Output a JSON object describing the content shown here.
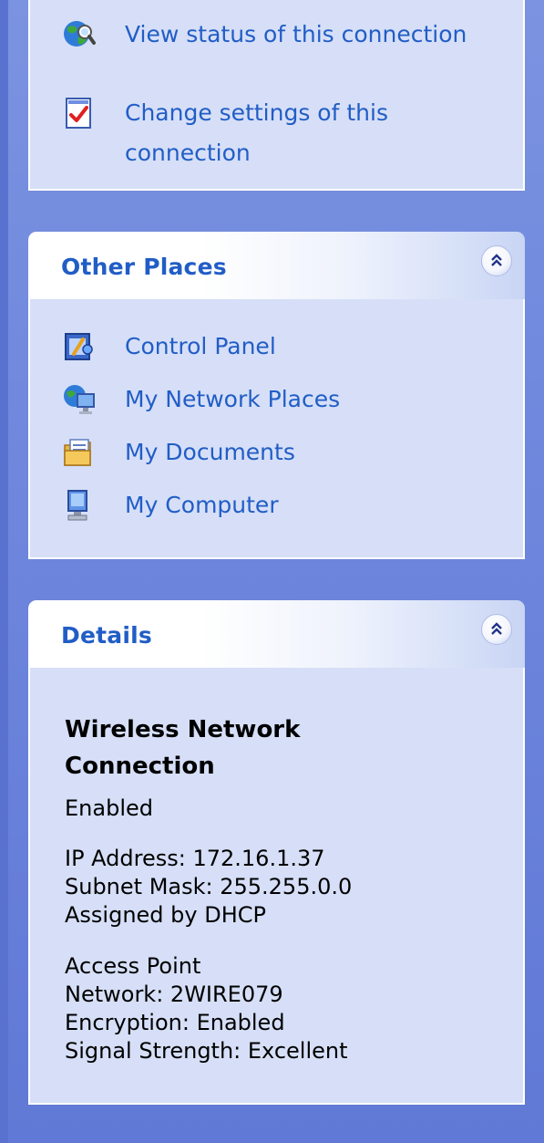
{
  "tasks": {
    "links": [
      {
        "label": "View status of this connection",
        "icon": "view-status-icon"
      },
      {
        "label": "Change settings of this connection",
        "icon": "change-settings-icon"
      }
    ]
  },
  "other_places": {
    "title": "Other Places",
    "collapse_icon": "double-chevron-up-icon",
    "links": [
      {
        "label": "Control Panel",
        "icon": "control-panel-icon"
      },
      {
        "label": "My Network Places",
        "icon": "network-places-icon"
      },
      {
        "label": "My Documents",
        "icon": "my-documents-icon"
      },
      {
        "label": "My Computer",
        "icon": "my-computer-icon"
      }
    ]
  },
  "details": {
    "title": "Details",
    "collapse_icon": "double-chevron-up-icon",
    "connection_name": "Wireless Network Connection",
    "status": "Enabled",
    "ip_address": "IP Address: 172.16.1.37",
    "subnet_mask": "Subnet Mask: 255.255.0.0",
    "assigned": "Assigned by DHCP",
    "access_point": "Access Point",
    "network": "Network: 2WIRE079",
    "encryption": "Encryption: Enabled",
    "signal": "Signal Strength: Excellent"
  },
  "colors": {
    "link": "#215dc6",
    "pane_background": "#6e86dc",
    "panel_body": "#d6dff7"
  }
}
